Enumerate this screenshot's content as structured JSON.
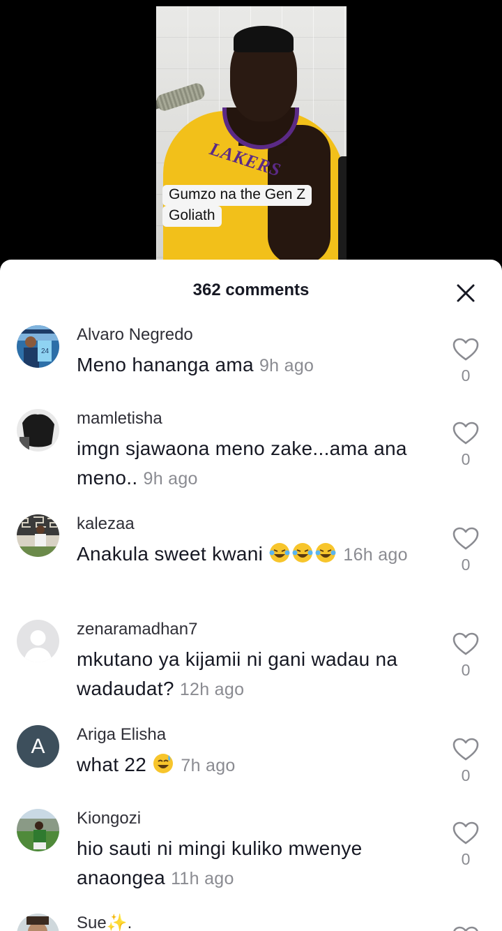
{
  "video": {
    "caption_line1": "Gumzo na the Gen Z",
    "caption_line2": "Goliath",
    "jersey_text": "LAKERS"
  },
  "sheet": {
    "title": "362 comments"
  },
  "comments": [
    {
      "username": "Alvaro Negredo",
      "text": "Meno hananga ama",
      "time": "9h ago",
      "likes": "0",
      "avatar": "photo"
    },
    {
      "username": "mamletisha",
      "text": "imgn sjawaona meno zake...ama ana meno..",
      "time": "9h ago",
      "likes": "0",
      "avatar": "photo"
    },
    {
      "username": "kalezaa",
      "text": "Anakula sweet kwani",
      "emoji": "laughing-tears-x3",
      "time": "16h ago",
      "likes": "0",
      "avatar": "photo"
    },
    {
      "username": "zenaramadhan7",
      "text": "mkutano ya kijamii ni gani wadau na wadaudat?",
      "time": "12h ago",
      "likes": "0",
      "avatar": "default"
    },
    {
      "username": "Ariga Elisha",
      "text": "what 22",
      "emoji": "sweat-smile",
      "time": "7h ago",
      "likes": "0",
      "avatar": "letter",
      "avatar_letter": "A"
    },
    {
      "username": "Kiongozi",
      "text": "hio sauti ni mingi kuliko mwenye anaongea",
      "time": "11h ago",
      "likes": "0",
      "avatar": "photo"
    },
    {
      "username": "Sue✨.",
      "avatar": "photo"
    }
  ],
  "colors": {
    "sheet_bg": "#ffffff",
    "text_primary": "#161823",
    "text_secondary": "#8a8b91",
    "avatar_letter_bg": "#3d4f5c",
    "caption_bg": "#f5f5f5"
  }
}
